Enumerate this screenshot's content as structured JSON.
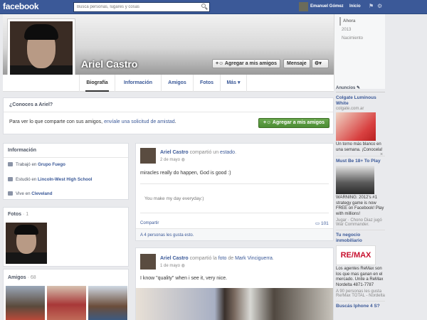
{
  "topbar": {
    "logo": "facebook",
    "search_placeholder": "Busca personas, lugares y cosas",
    "user_name": "Emanuel Gómez",
    "home_label": "Inicio"
  },
  "profile": {
    "name": "Ariel Castro",
    "add_friend_label": "Agregar a mis amigos",
    "message_label": "Mensaje",
    "settings_label": "▾"
  },
  "nav_tabs": [
    {
      "label": "Biografía"
    },
    {
      "label": "Información"
    },
    {
      "label": "Amigos"
    },
    {
      "label": "Fotos"
    },
    {
      "label": "Más ▾"
    }
  ],
  "know_box": {
    "title": "¿Conoces a Ariel?",
    "text_prefix": "Para ver lo que comparte con sus amigos, ",
    "text_link": "envíale una solicitud de amistad",
    "text_suffix": ".",
    "button": "Agregar a mis amigos"
  },
  "info": {
    "title": "Información",
    "rows": [
      {
        "prefix": "Trabajó en ",
        "value": "Grupo Fuego"
      },
      {
        "prefix": "Estudió en ",
        "value": "Lincoln-West High School"
      },
      {
        "prefix": "Vive en ",
        "value": "Cleveland"
      }
    ]
  },
  "photos": {
    "title": "Fotos",
    "count": "· 1"
  },
  "friends": {
    "title": "Amigos",
    "count": "· 68"
  },
  "posts": [
    {
      "author": "Ariel Castro",
      "action": " compartió un ",
      "target": "estado",
      "target_suffix": ".",
      "date": "2 de mayo",
      "text": "miracles really do happen, God is good :)",
      "quote": "You make my day everyday:)",
      "share_label": "Compartir",
      "comment_count": "101",
      "likes": "A 4 personas les gusta esto."
    },
    {
      "author": "Ariel Castro",
      "action": " compartió la ",
      "target": "foto",
      "target_mid": " de ",
      "target2": "Mark Vinciguerra",
      "target_suffix": ".",
      "date": "1 de mayo",
      "text": "I know \"quality\" when i see it, very nice."
    }
  ],
  "timeline": {
    "years": [
      "Ahora",
      "2013",
      "Nacimiento"
    ]
  },
  "ads": {
    "header": "Anuncios",
    "items": [
      {
        "title": "Colgate Luminous White",
        "sub": "colgate.com.ar",
        "text": "Un torno más blanco en una semana. ¡Conocela!"
      },
      {
        "title": "Must Be 18+ To Play",
        "sub": "",
        "text": "WARNING: 2012's #1 strategy game is now FREE on Facebook! Play with millions!"
      },
      {
        "title": "",
        "sub": "",
        "text": "Jugar · Chono Diaz jugó War Commander."
      },
      {
        "title": "Tu negocio inmobiliario",
        "sub": "",
        "text": "Los agentes ReMax son los que mas ganan en el mercado. Unite a ReMax Nordelta 4871-7787"
      },
      {
        "title": "",
        "sub": "",
        "text": "A 90 personas les gusta Re/Max TOTAL - Nordelta"
      },
      {
        "title": "Buscás Iphone 4 S?",
        "sub": "",
        "text": ""
      }
    ]
  },
  "colors": {
    "brand": "#3b5998",
    "green_button": "#4c8d35",
    "background": "#e9eaed"
  }
}
